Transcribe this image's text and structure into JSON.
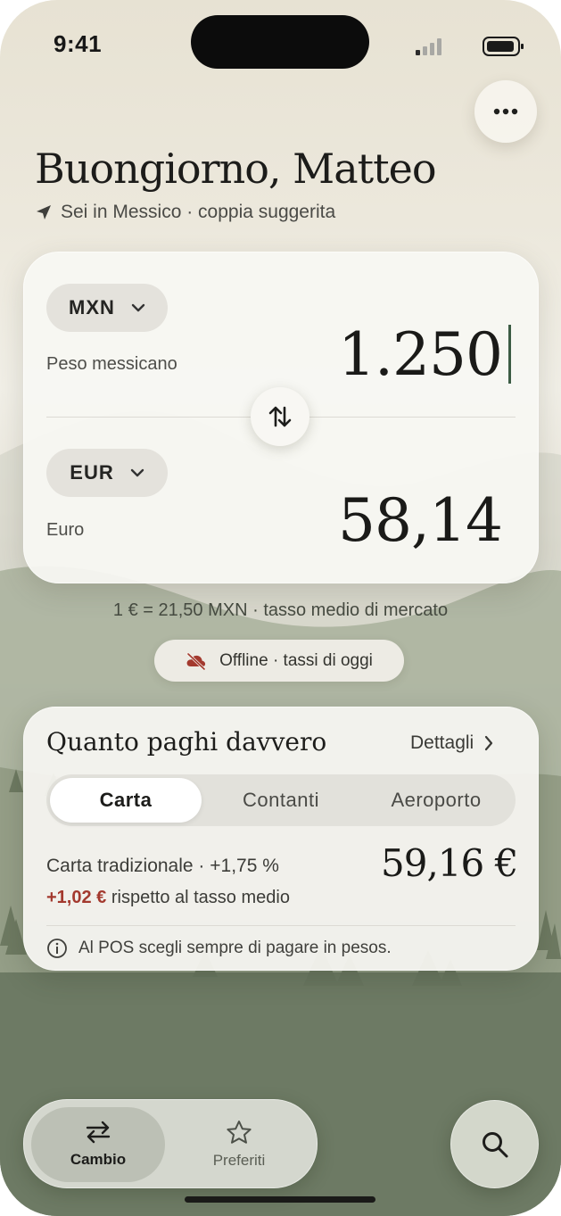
{
  "status_bar": {
    "time": "9:41"
  },
  "header": {
    "greeting": "Buongiorno, Matteo",
    "location": "Sei in Messico · coppia suggerita"
  },
  "converter": {
    "from": {
      "code": "MXN",
      "name": "Peso messicano",
      "amount": "1.250"
    },
    "to": {
      "code": "EUR",
      "name": "Euro",
      "amount": "58,14"
    },
    "caret_color": "#3c5c44"
  },
  "rate_info": "1 € = 21,50 MXN · tasso medio di mercato",
  "offline_badge": {
    "label": "Offline · tassi di oggi",
    "icon": "cloud-off-icon",
    "icon_color": "#a3392e"
  },
  "cost_card": {
    "title": "Quanto paghi davvero",
    "details_link": "Dettagli",
    "tabs": [
      {
        "label": "Carta",
        "active": true
      },
      {
        "label": "Contanti",
        "active": false
      },
      {
        "label": "Aeroporto",
        "active": false
      }
    ],
    "method_label": "Carta tradizionale · +1,75 %",
    "total": "59,16 €",
    "extra_amount": "+1,02 €",
    "extra_text": "rispetto al tasso medio",
    "extra_color": "#a3392e",
    "tip": "Al POS scegli sempre di pagare in pesos."
  },
  "tab_bar": {
    "items": [
      {
        "label": "Cambio",
        "icon": "swap-arrows-icon",
        "active": true
      },
      {
        "label": "Preferiti",
        "icon": "star-icon",
        "active": false
      }
    ]
  },
  "actions": {
    "more": "more-icon",
    "search": "search-icon"
  }
}
